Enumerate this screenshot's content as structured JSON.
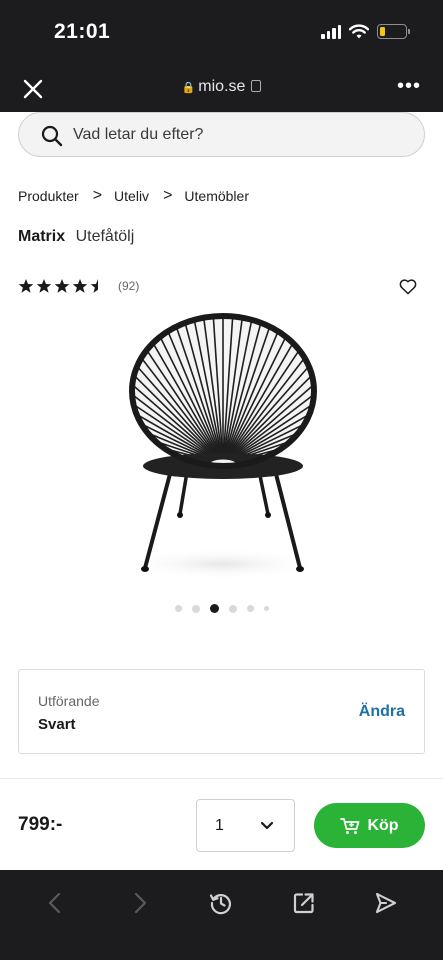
{
  "status_bar": {
    "time": "21:01",
    "battery_color": "#f5c518"
  },
  "browser": {
    "url": "mio.se",
    "close_icon": "close-icon",
    "more_icon": "more-icon"
  },
  "search": {
    "placeholder": "Vad letar du efter?"
  },
  "breadcrumb": {
    "items": [
      "Produkter",
      "Uteliv",
      "Utemöbler"
    ],
    "separator": ">"
  },
  "product": {
    "brand": "Matrix",
    "name": "Utefåtölj",
    "rating": 4.5,
    "rating_max": 5,
    "review_count": "(92)"
  },
  "carousel": {
    "total": 6,
    "active_index": 2
  },
  "variant": {
    "label": "Utförande",
    "value": "Svart",
    "change_label": "Ändra"
  },
  "purchase": {
    "price": "799:-",
    "quantity": "1",
    "buy_label": "Köp",
    "buy_color": "#2bb338"
  },
  "toolbar": {
    "icons": [
      "back-icon",
      "forward-icon",
      "history-icon",
      "share-icon",
      "send-icon"
    ]
  }
}
